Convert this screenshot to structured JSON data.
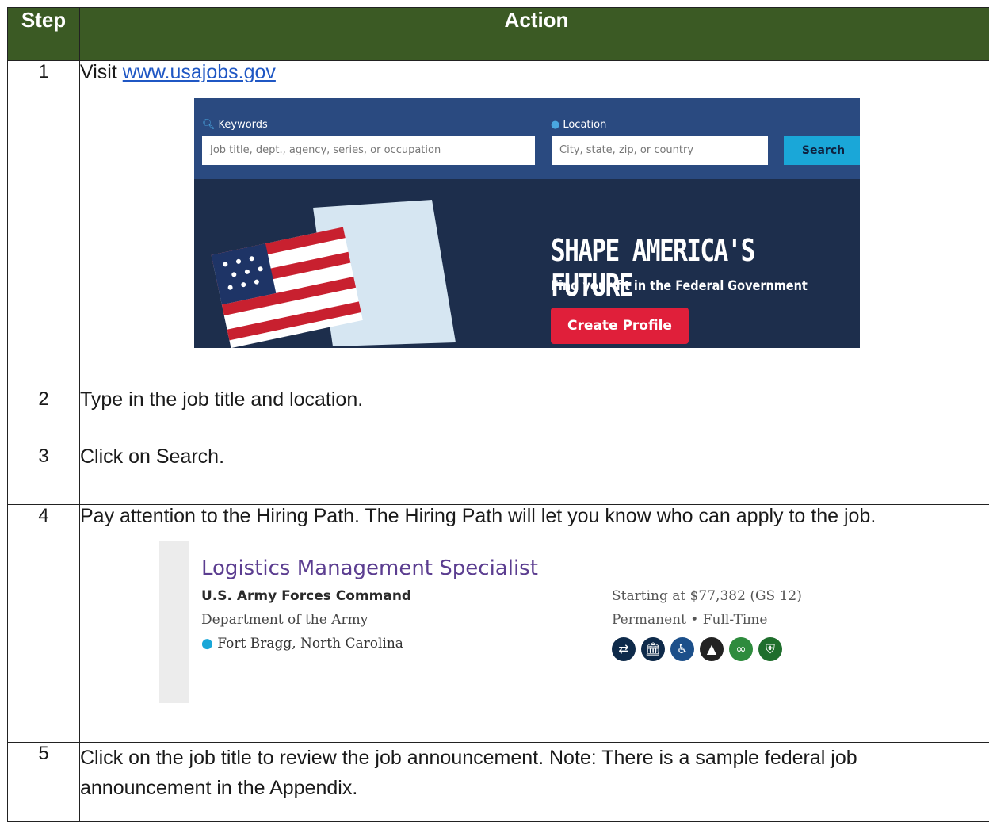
{
  "header": {
    "step": "Step",
    "action": "Action"
  },
  "rows": [
    {
      "num": "1",
      "prefix": "Visit ",
      "link": "www.usajobs.gov"
    },
    {
      "num": "2",
      "text": "Type in the job title and location."
    },
    {
      "num": "3",
      "text": "Click on Search."
    },
    {
      "num": "4",
      "text": "Pay attention to the Hiring Path. The Hiring Path will let you know who can apply to the job."
    },
    {
      "num": "5",
      "text": "Click on the job title to review the job announcement.  Note: There is a sample federal job announcement in the Appendix."
    }
  ],
  "hero": {
    "keywords_label": "Keywords",
    "keywords_placeholder": "Job title, dept., agency, series, or occupation",
    "location_label": "Location",
    "location_placeholder": "City, state, zip, or country",
    "search_label": "Search",
    "headline": "SHAPE AMERICA'S FUTURE",
    "subline": "Find your fit in the Federal Government",
    "profile_button": "Create Profile",
    "colors": {
      "banner": "#1d2e4c",
      "bar": "#2a4a80",
      "search": "#1aa7d8",
      "profile": "#e01f3a"
    }
  },
  "job": {
    "title": "Logistics Management Specialist",
    "agency": "U.S. Army Forces Command",
    "department": "Department of the Army",
    "location": "Fort Bragg, North Carolina",
    "salary": "Starting at $77,382 (GS 12)",
    "schedule": "Permanent • Full-Time",
    "hiring_path_icons": [
      {
        "name": "internal-to-agency-icon",
        "glyph": "⇄",
        "color": "#0e2a4a"
      },
      {
        "name": "federal-employee-icon",
        "glyph": "🏛",
        "color": "#0e2a4a"
      },
      {
        "name": "disability-icon",
        "glyph": "♿",
        "color": "#1c4f8a"
      },
      {
        "name": "land-management-icon",
        "glyph": "▲",
        "color": "#222222"
      },
      {
        "name": "career-transition-icon",
        "glyph": "∞",
        "color": "#2e8b3d"
      },
      {
        "name": "veterans-icon",
        "glyph": "⛨",
        "color": "#1f6e2c"
      }
    ]
  }
}
